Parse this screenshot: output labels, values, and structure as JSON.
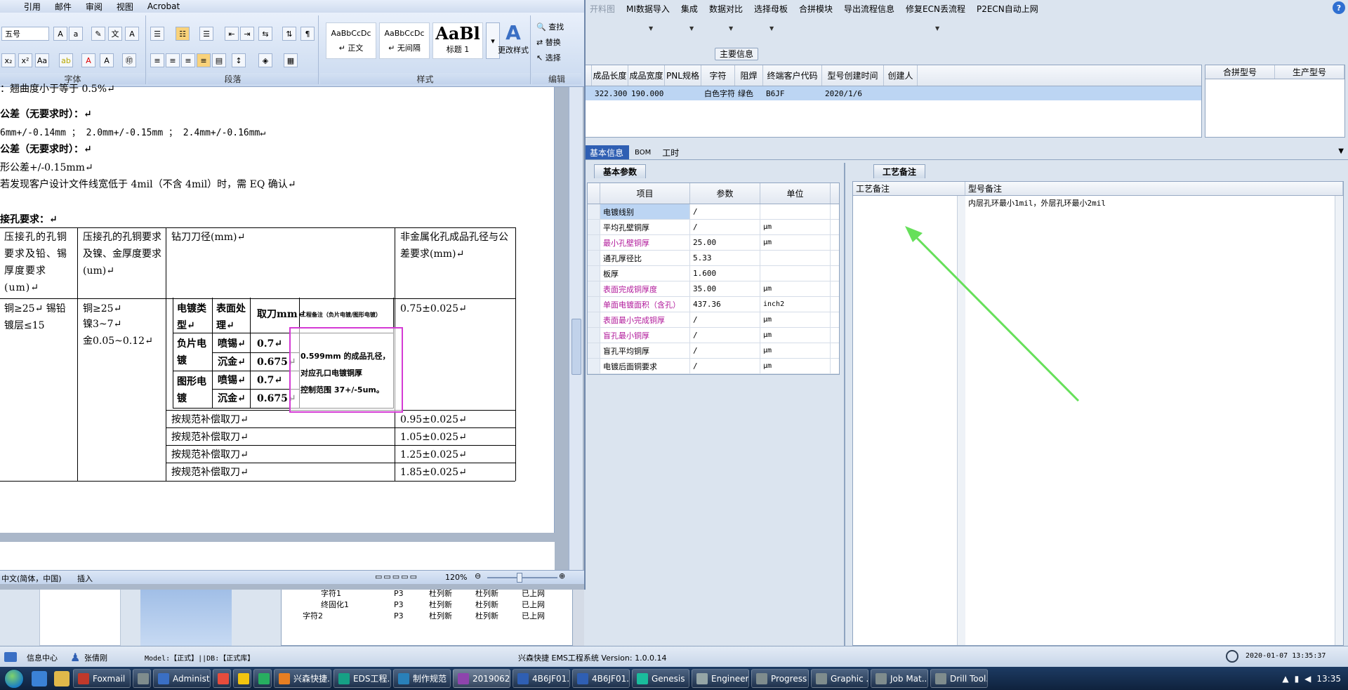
{
  "word": {
    "menu": [
      "邮件",
      "审阅",
      "视图",
      "Acrobat"
    ],
    "menu_first": "引用",
    "font_size": "五号",
    "groups": {
      "font": "字体",
      "paragraph": "段落",
      "styles": "样式",
      "edit": "编辑"
    },
    "styles": [
      {
        "preview": "AaBbCcDc",
        "name": "↵ 正文"
      },
      {
        "preview": "AaBbCcDc",
        "name": "↵ 无间隔"
      },
      {
        "preview": "AaBl",
        "name": "标题 1"
      }
    ],
    "change_styles": "更改样式",
    "edit_items": [
      "查找",
      "替换",
      "选择"
    ],
    "doc_lines": [
      "：翘曲度小于等于 0.5%↵",
      "公差（无要求时）：↵",
      "6mm+/-0.14mm ； 2.0mm+/-0.15mm ； 2.4mm+/-0.16mm↵",
      "公差（无要求时）：↵",
      "形公差+/-0.15mm↵",
      "若发现客户设计文件线宽低于 4mil（不含 4mil）时，需 EQ 确认↵",
      "接孔要求：↵"
    ],
    "table": {
      "h1": "压接孔的孔铜要求及铅、锡厚度要求(um)↵",
      "h2": "压接孔的孔铜要求及镍、金厚度要求(um)↵",
      "h3": "钻刀刀径(mm)↵",
      "h4": "非金属化孔成品孔径与公差要求(mm)↵",
      "c1": "铜≥25↵ 锡铅镀层≤15",
      "c2a": "铜≥25↵",
      "c2b": "镍3~7↵",
      "c2c": "金0.05~0.12↵",
      "sub_h1": "电镀类型↵",
      "sub_h2": "表面处理↵",
      "sub_h3": "取刀mm↵",
      "sub_h4": "工程备注（负片电镀/图形电镀）",
      "neg": "负片电镀",
      "pat": "图形电镀",
      "spray": "喷锡↵",
      "gold": "沉金↵",
      "v07": "0.7↵",
      "v0675": "0.675↵",
      "r1": "0.75±0.025↵",
      "comp": "按规范补偿取刀↵",
      "r2": "0.95±0.025↵",
      "r3": "1.05±0.025↵",
      "r4": "1.25±0.025↵",
      "r5": "1.85±0.025↵"
    },
    "note_lines": [
      "0.599mm 的成品孔径，",
      "对应孔口电镀铜厚",
      "控制范围 37+/-5um。"
    ],
    "status_lang": "中文(简体，中国)",
    "status_insert": "插入",
    "zoom": "120%"
  },
  "app": {
    "menu_dim": "开料图",
    "menu": [
      "MI数据导入",
      "集成",
      "数据对比",
      "选择母板",
      "合拼模块",
      "导出流程信息",
      "修复ECN丢流程",
      "P2ECN自动上网"
    ],
    "main_info_label": "主要信息",
    "grid1_headers": [
      "成品长度",
      "成品宽度",
      "PNL规格",
      "字符",
      "阻焊",
      "终端客户代码",
      "型号创建时间",
      "创建人"
    ],
    "grid1_row": [
      "322.300",
      "190.000",
      "",
      "白色字符",
      "绿色",
      "B6JF",
      "2020/1/6",
      ""
    ],
    "grid2_headers": [
      "合拼型号",
      "生产型号"
    ],
    "tabs": [
      "基本信息",
      "BOM",
      "工时"
    ],
    "subtab_left": "基本参数",
    "subtab_right": "工艺备注",
    "param_headers": [
      "项目",
      "参数",
      "单位"
    ],
    "params": [
      {
        "item": "电镀线别",
        "val": "/",
        "unit": "",
        "magenta": false
      },
      {
        "item": "平均孔壁铜厚",
        "val": "/",
        "unit": "μm",
        "magenta": false
      },
      {
        "item": "最小孔壁铜厚",
        "val": "25.00",
        "unit": "μm",
        "magenta": true
      },
      {
        "item": "通孔厚径比",
        "val": "5.33",
        "unit": "",
        "magenta": false
      },
      {
        "item": "板厚",
        "val": "1.600",
        "unit": "",
        "magenta": false
      },
      {
        "item": "表面完成铜厚度",
        "val": "35.00",
        "unit": "μm",
        "magenta": true
      },
      {
        "item": "单面电镀面积（含孔）",
        "val": "437.36",
        "unit": "inch2",
        "magenta": true
      },
      {
        "item": "表面最小完成铜厚",
        "val": "/",
        "unit": "μm",
        "magenta": true
      },
      {
        "item": "盲孔最小铜厚",
        "val": "/",
        "unit": "μm",
        "magenta": true
      },
      {
        "item": "盲孔平均铜厚",
        "val": "/",
        "unit": "μm",
        "magenta": false
      },
      {
        "item": "电镀后面铜要求",
        "val": "/",
        "unit": "μm",
        "magenta": false
      }
    ],
    "notes_headers": [
      "工艺备注",
      "型号备注"
    ],
    "model_note": "内层孔环最小1mil，外层孔环最小2mil",
    "tree": [
      {
        "name": "字符1",
        "c1": "P3",
        "c2": "杜列新",
        "c3": "杜列新",
        "c4": "已上网"
      },
      {
        "name": "终固化1",
        "c1": "P3",
        "c2": "杜列新",
        "c3": "杜列新",
        "c4": "已上网"
      },
      {
        "name": "字符2",
        "c1": "P3",
        "c2": "杜列新",
        "c3": "杜列新",
        "c4": "已上网"
      }
    ],
    "status": {
      "info_center": "信息中心",
      "user": "张倩刚",
      "model": "Model:【正式】||DB:【正式库】",
      "system": "兴森快捷  EMS工程系统  Version: 1.0.0.14",
      "datetime": "2020-01-07 13:35:37"
    }
  },
  "taskbar": {
    "items": [
      "Foxmail",
      "",
      "Administ...",
      "",
      "",
      "",
      "兴森快捷...",
      "EDS工程...",
      "制作规范 ...",
      "2019062...",
      "4B6JF01...",
      "4B6JF01...",
      "Genesis",
      "Engineer...",
      "Progress",
      "Graphic ...",
      "Job Mat...",
      "Drill Tool..."
    ],
    "clock": "13:35"
  },
  "colors": {
    "accent": "#2f5fb3",
    "magenta": "#b0189a",
    "selection": "#bcd5f3",
    "arrow": "#66e05a",
    "highlight_box": "#d43ad4"
  }
}
